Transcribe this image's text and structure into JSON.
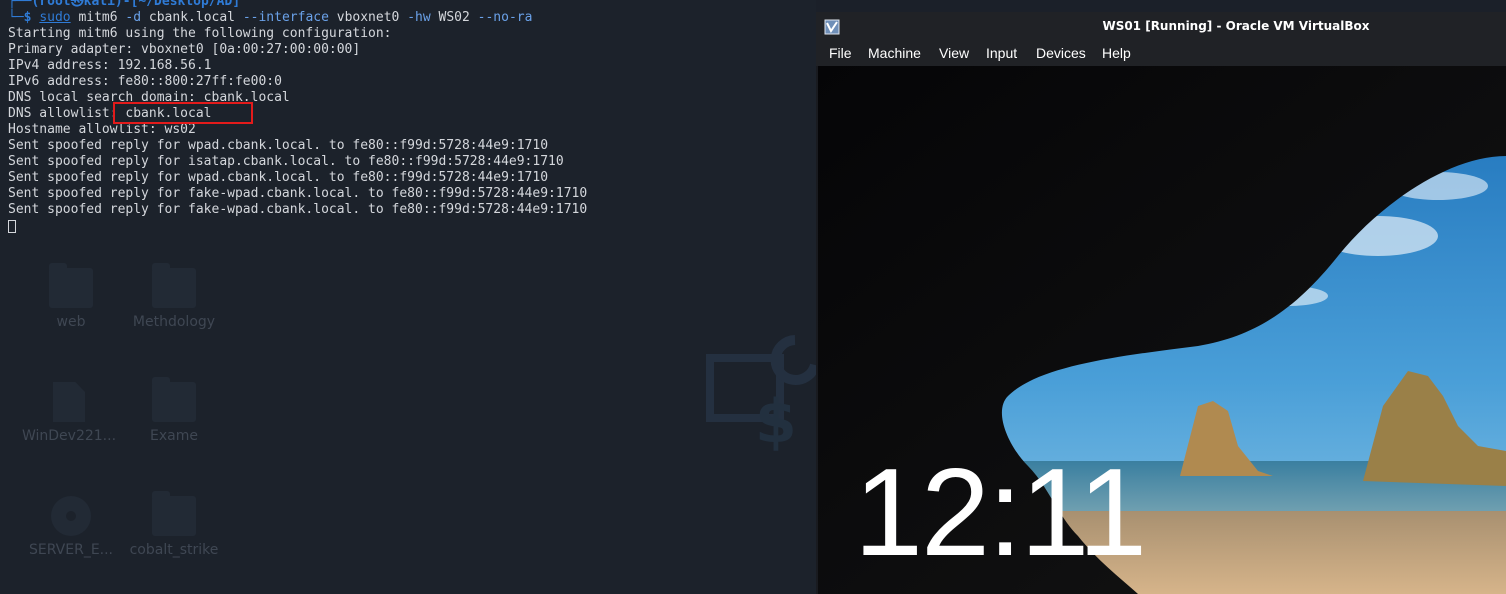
{
  "terminal": {
    "prompt_top": "┌──(root㉿kali)-[~/Desktop/AD]",
    "prompt_arrow": "└─$",
    "command": {
      "sudo": "sudo",
      "prog": "mitm6",
      "opt_d": "-d",
      "domain": "cbank.local",
      "opt_interface": "--interface",
      "iface": "vboxnet0",
      "opt_hw": "-hw",
      "host": "WS02",
      "opt_nora": "--no-ra"
    },
    "output": [
      "Starting mitm6 using the following configuration:",
      "Primary adapter: vboxnet0 [0a:00:27:00:00:00]",
      "IPv4 address: 192.168.56.1",
      "IPv6 address: fe80::800:27ff:fe00:0",
      "DNS local search domain: cbank.local",
      "DNS allowlist: cbank.local",
      "Hostname allowlist: ws02",
      "Sent spoofed reply for wpad.cbank.local. to fe80::f99d:5728:44e9:1710",
      "Sent spoofed reply for isatap.cbank.local. to fe80::f99d:5728:44e9:1710",
      "Sent spoofed reply for wpad.cbank.local. to fe80::f99d:5728:44e9:1710",
      "Sent spoofed reply for fake-wpad.cbank.local. to fe80::f99d:5728:44e9:1710",
      "Sent spoofed reply for fake-wpad.cbank.local. to fe80::f99d:5728:44e9:1710"
    ],
    "highlight_color": "#e31b1b"
  },
  "desktop": {
    "icons": [
      {
        "label": "web",
        "icon": "folder-icon"
      },
      {
        "label": "Methdology",
        "icon": "folder-icon"
      },
      {
        "label": "WinDev221...",
        "icon": "file-icon"
      },
      {
        "label": "Exame",
        "icon": "folder-icon"
      },
      {
        "label": "SERVER_E...",
        "icon": "disc-icon"
      },
      {
        "label": "cobalt_strike",
        "icon": "folder-icon"
      }
    ]
  },
  "vbox": {
    "title": "WS01 [Running] - Oracle VM VirtualBox",
    "menu": [
      "File",
      "Machine",
      "View",
      "Input",
      "Devices",
      "Help"
    ],
    "screen": {
      "clock": "12:11"
    }
  },
  "colors": {
    "terminal_bg": "#1c222b",
    "prompt_blue": "#2f7bd6",
    "vbox_chrome": "#202226"
  }
}
